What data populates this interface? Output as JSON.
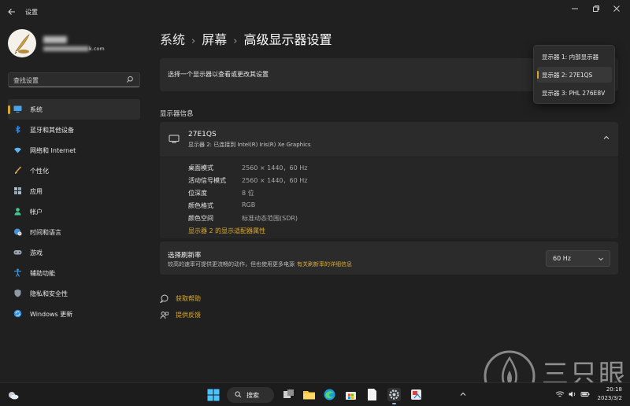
{
  "window": {
    "title": "设置",
    "back_icon": "arrow-left-icon"
  },
  "user": {
    "email_suffix": "k.com"
  },
  "search": {
    "placeholder": "查找设置"
  },
  "sidebar": {
    "items": [
      {
        "label": "系统",
        "icon": "monitor-icon",
        "active": true
      },
      {
        "label": "蓝牙和其他设备",
        "icon": "bluetooth-icon"
      },
      {
        "label": "网络和 Internet",
        "icon": "wifi-icon"
      },
      {
        "label": "个性化",
        "icon": "brush-icon"
      },
      {
        "label": "应用",
        "icon": "apps-icon"
      },
      {
        "label": "帐户",
        "icon": "person-icon"
      },
      {
        "label": "时间和语言",
        "icon": "globe-clock-icon"
      },
      {
        "label": "游戏",
        "icon": "gamepad-icon"
      },
      {
        "label": "辅助功能",
        "icon": "accessibility-icon"
      },
      {
        "label": "隐私和安全性",
        "icon": "shield-icon"
      },
      {
        "label": "Windows 更新",
        "icon": "update-icon"
      }
    ]
  },
  "breadcrumb": {
    "part1": "系统",
    "part2": "屏幕",
    "current": "高级显示器设置"
  },
  "display_select": {
    "label": "选择一个显示器以查看或更改其设置",
    "options": [
      "显示器 1: 内部显示器",
      "显示器 2: 27E1QS",
      "显示器 3: PHL 276E8V"
    ],
    "selected": "显示器 2: 27E1QS"
  },
  "display_info": {
    "section_title": "显示器信息",
    "name": "27E1QS",
    "subtitle": "显示器 2: 已连接到 Intel(R) Iris(R) Xe Graphics",
    "rows": [
      {
        "key": "桌面模式",
        "value": "2560 × 1440，60 Hz"
      },
      {
        "key": "活动信号模式",
        "value": "2560 × 1440，60 Hz"
      },
      {
        "key": "位深度",
        "value": "8 位"
      },
      {
        "key": "颜色格式",
        "value": "RGB"
      },
      {
        "key": "颜色空间",
        "value": "标准动态范围(SDR)"
      }
    ],
    "adapter_link": "显示器 2 的显示适配器属性"
  },
  "refresh": {
    "title": "选择刷新率",
    "subtitle": "较高的速率可提供更流畅的动作，但也使用更多电源",
    "link": "有关刷新率的详细信息",
    "value": "60 Hz"
  },
  "help": {
    "get_help": "获取帮助",
    "feedback": "提供反馈"
  },
  "taskbar": {
    "search_label": "搜索",
    "time": "20:18",
    "date": "2023/3/2"
  },
  "watermark": {
    "text": "三只眼"
  },
  "colors": {
    "accent": "#d9ab34",
    "background": "#202020",
    "card": "#2b2b2b"
  }
}
